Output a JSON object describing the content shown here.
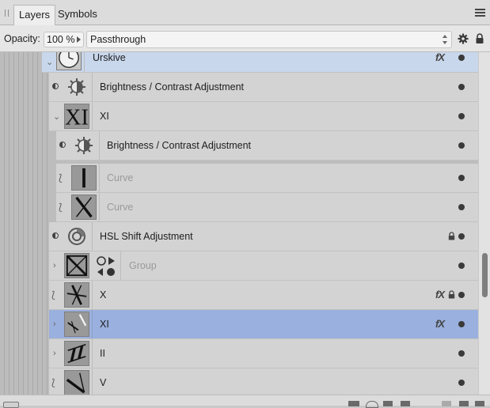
{
  "tabs": [
    {
      "label": "Layers",
      "active": true
    },
    {
      "label": "Symbols",
      "active": false
    }
  ],
  "toolbar": {
    "opacity_label": "Opacity:",
    "opacity_value": "100 %",
    "blend_mode": "Passthrough"
  },
  "layers": [
    {
      "name": "Urskive",
      "kind": "group",
      "indent": 0,
      "expanded": true,
      "fx": true,
      "locked": false,
      "dimmed": false,
      "selected": "light",
      "icon": "clock-thumbnail-icon"
    },
    {
      "name": "Brightness / Contrast Adjustment",
      "kind": "adjustment",
      "indent": 1,
      "fx": false,
      "locked": false,
      "dimmed": false,
      "icon": "brightness-contrast-icon"
    },
    {
      "name": "XI",
      "kind": "group",
      "indent": 1,
      "expanded": true,
      "fx": false,
      "locked": false,
      "dimmed": false,
      "icon": "roman-XI-thumbnail-icon"
    },
    {
      "name": "Brightness / Contrast Adjustment",
      "kind": "adjustment",
      "indent": 2,
      "fx": false,
      "locked": false,
      "dimmed": false,
      "icon": "brightness-contrast-icon"
    },
    {
      "name": "Curve",
      "kind": "curve",
      "indent": 2,
      "fx": false,
      "locked": false,
      "dimmed": true,
      "icon": "roman-I-thumbnail-icon"
    },
    {
      "name": "Curve",
      "kind": "curve",
      "indent": 2,
      "fx": false,
      "locked": false,
      "dimmed": true,
      "icon": "roman-X-thumbnail-icon"
    },
    {
      "name": "HSL Shift Adjustment",
      "kind": "adjustment",
      "indent": 1,
      "fx": false,
      "locked": true,
      "dimmed": false,
      "icon": "hsl-shift-icon"
    },
    {
      "name": "Group",
      "kind": "group",
      "indent": 1,
      "expanded": false,
      "fx": false,
      "locked": false,
      "dimmed": true,
      "icon": "group-thumbnail-icon"
    },
    {
      "name": "X",
      "kind": "curve",
      "indent": 1,
      "fx": true,
      "locked": true,
      "dimmed": false,
      "icon": "roman-X-thumbnail-icon"
    },
    {
      "name": "XI",
      "kind": "group",
      "indent": 1,
      "expanded": false,
      "fx": true,
      "locked": false,
      "dimmed": false,
      "selected": "strong",
      "icon": "roman-XI-thumbnail-icon"
    },
    {
      "name": "II",
      "kind": "group",
      "indent": 1,
      "expanded": false,
      "fx": false,
      "locked": false,
      "dimmed": false,
      "icon": "roman-II-thumbnail-icon"
    },
    {
      "name": "V",
      "kind": "curve",
      "indent": 1,
      "fx": false,
      "locked": false,
      "dimmed": false,
      "icon": "roman-V-thumbnail-icon"
    }
  ],
  "fx_label": "fX",
  "colors": {
    "selection_strong": "#9ab0de",
    "selection_light": "#c9d7ec",
    "row_bg": "#d3d3d3"
  }
}
